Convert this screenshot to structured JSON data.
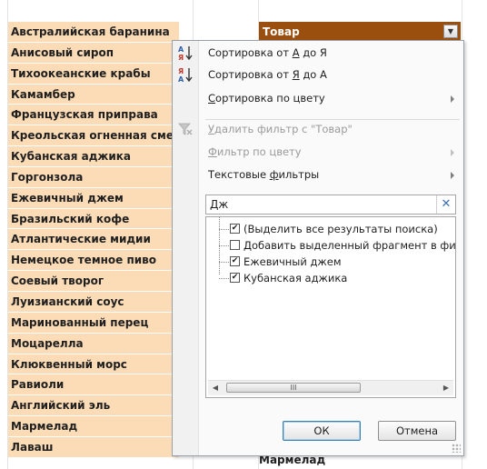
{
  "product_list": [
    "Австралийская баранина",
    "Анисовый сироп",
    "Тихоокеанские крабы",
    "Камамбер",
    "Французская приправа",
    "Креольская огненная смесь",
    "Кубанская аджика",
    "Горгонзола",
    "Ежевичный джем",
    "Бразильский кофе",
    "Атлантические мидии",
    "Немецкое темное пиво",
    "Соевый творог",
    "Луизианский соус",
    "Маринованный перец",
    "Моцарелла",
    "Клюквенный морс",
    "Равиоли",
    "Английский эль",
    "Мармелад",
    "Лаваш"
  ],
  "header": {
    "label": "Товар"
  },
  "bottom_value": "Мармелад",
  "menu": {
    "sort_asc": {
      "pre": "Сортировка от ",
      "u": "А",
      "post": " до Я"
    },
    "sort_desc": {
      "pre": "Сортировка от ",
      "u": "Я",
      "post": " до А"
    },
    "sort_color": {
      "pre": "",
      "u": "С",
      "post": "ортировка по цвету"
    },
    "clear_filter": {
      "pre": "",
      "u": "У",
      "post": "далить фильтр с \"Товар\""
    },
    "filter_color": {
      "pre": "",
      "u": "Ф",
      "post": "ильтр по цвету"
    },
    "text_filters": {
      "pre": "Текстовые ",
      "u": "ф",
      "post": "ильтры"
    }
  },
  "search": {
    "value": "Дж",
    "clear_icon": "✕"
  },
  "checklist": [
    {
      "label": "(Выделить все результаты поиска)",
      "checked": true
    },
    {
      "label": "Добавить выделенный фрагмент в фильтр",
      "checked": false
    },
    {
      "label": "Ежевичный джем",
      "checked": true
    },
    {
      "label": "Кубанская аджика",
      "checked": true
    }
  ],
  "buttons": {
    "ok": "ОК",
    "cancel": "Отмена"
  },
  "colors": {
    "header_bg": "#9b4f0f",
    "row_bg": "#fbdcb7",
    "accent": "#3e6fb3"
  }
}
